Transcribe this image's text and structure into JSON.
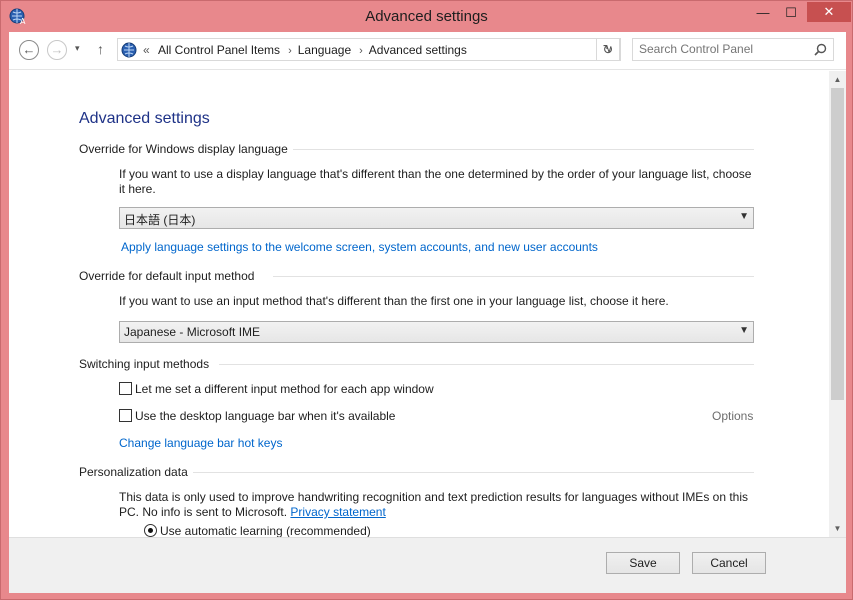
{
  "window": {
    "title": "Advanced settings"
  },
  "titlebar_buttons": {
    "minimize": "—",
    "maximize": "☐",
    "close": "✕"
  },
  "navigation": {
    "back_glyph": "←",
    "forward_glyph": "→",
    "recent_glyph": "▾",
    "up_glyph": "↑",
    "address_prefix": "«",
    "breadcrumbs": [
      "All Control Panel Items",
      "Language",
      "Advanced settings"
    ],
    "address_dropdown_glyph": "∨",
    "refresh_glyph": "↻",
    "search_placeholder": "Search Control Panel"
  },
  "page": {
    "title": "Advanced settings",
    "display_language": {
      "heading": "Override for Windows display language",
      "description": "If you want to use a display language that's different than the one determined by the order of your language list, choose it here.",
      "selected": "日本語 (日本)",
      "apply_link": "Apply language settings to the welcome screen, system accounts, and new user accounts"
    },
    "input_method": {
      "heading": "Override for default input method",
      "description": "If you want to use an input method that's different than the first one in your language list, choose it here.",
      "selected": "Japanese - Microsoft IME"
    },
    "switching": {
      "heading": "Switching input methods",
      "option_per_app": "Let me set a different input method for each app window",
      "option_language_bar": "Use the desktop language bar when it's available",
      "options_link": "Options",
      "hotkeys_link": "Change language bar hot keys"
    },
    "personalization": {
      "heading": "Personalization data",
      "description": "This data is only used to improve handwriting recognition and text prediction results for languages without IMEs on this PC. No info is sent to Microsoft.",
      "privacy_link": "Privacy statement",
      "radio_auto": "Use automatic learning (recommended)"
    }
  },
  "footer": {
    "save": "Save",
    "cancel": "Cancel"
  },
  "colors": {
    "titlebar": "#e8888c",
    "heading_blue": "#1e3287",
    "link_blue": "#0066cc",
    "close_red": "#c75050"
  }
}
